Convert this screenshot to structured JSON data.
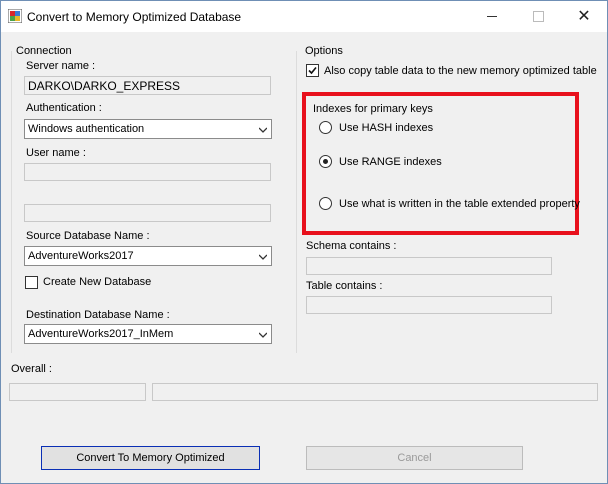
{
  "window": {
    "title": "Convert to Memory Optimized Database",
    "close_glyph": "✕"
  },
  "connection": {
    "group_label": "Connection",
    "server_name_label": "Server name :",
    "server_name_value": "DARKO\\DARKO_EXPRESS",
    "authentication_label": "Authentication :",
    "authentication_value": "Windows authentication",
    "user_name_label": "User name :",
    "user_name_value": "",
    "password_value": "",
    "source_db_label": "Source Database Name :",
    "source_db_value": "AdventureWorks2017",
    "create_new_db_label": "Create New Database",
    "create_new_db_checked": false,
    "dest_db_label": "Destination Database Name :",
    "dest_db_value": "AdventureWorks2017_InMem"
  },
  "options": {
    "group_label": "Options",
    "copy_data_label": "Also copy table data to the new memory optimized table",
    "copy_data_checked": true,
    "indexes_label": "Indexes for primary keys",
    "radio_hash": "Use HASH indexes",
    "radio_range": "Use RANGE indexes",
    "radio_ext": "Use what is written in the table extended property",
    "selected_index": "range",
    "schema_contains_label": "Schema contains :",
    "schema_contains_value": "",
    "table_contains_label": "Table contains :",
    "table_contains_value": ""
  },
  "overall": {
    "label": "Overall :"
  },
  "buttons": {
    "convert": "Convert To Memory Optimized",
    "cancel": "Cancel"
  },
  "colors": {
    "highlight_border": "#e8101c",
    "primary_button_border": "#0a2fb5"
  }
}
